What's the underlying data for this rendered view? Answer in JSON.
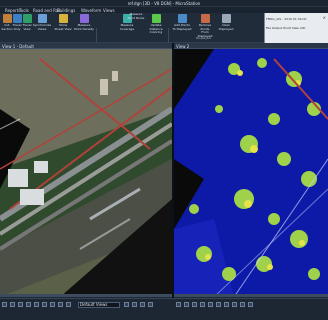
{
  "window": {
    "title": "ref.dgn [3D - V8 DGN] - MicroStation"
  },
  "tabs": [
    "Reports",
    "Tools",
    "Road and Rail",
    "Buildings",
    "Waveform",
    "Views"
  ],
  "ribbon": {
    "buttons": [
      {
        "label": "Cut\nSection",
        "color": "#c0803a"
      },
      {
        "label": "Travel\nOnly",
        "color": "#3d7fc4"
      },
      {
        "label": "Travel\nView",
        "color": "#2f9f6a"
      },
      {
        "label": "Synchronize\nViews",
        "color": "#6a9fd8"
      },
      {
        "label": "Show\nStreet View",
        "color": "#d8b23a"
      },
      {
        "label": "Measure\nPoint Density",
        "color": "#8a6ad8"
      },
      {
        "label": "Measure\nCoverage",
        "color": "#3ab0a8"
      },
      {
        "label": "Measure\nPoint Noise",
        "color": "#c84a4a"
      },
      {
        "label": "Update\nDistance Coloring",
        "color": "#5ac84a"
      },
      {
        "label": "Add Points\nTo Displayed",
        "color": "#4a8ac8"
      },
      {
        "label": "Remove Points\nFrom Displayed",
        "color": "#c86a4a"
      },
      {
        "label": "Clear\nDisplayed",
        "color": "#9aa8b8"
      }
    ],
    "group_label": "Displayed"
  },
  "right_panel": {
    "title": "FMRG_GIS - 2016 01 06.txt",
    "tabs": "File  Output  Point  View  Info"
  },
  "views": {
    "left_title": "View 1 - Default",
    "right_title": "View 2"
  },
  "status": {
    "views_select": "Default Views"
  },
  "icons": [
    "views-icon",
    "grid-icon",
    "zoom-icon",
    "pan-icon",
    "rotate-icon",
    "fit-icon",
    "window-icon"
  ]
}
